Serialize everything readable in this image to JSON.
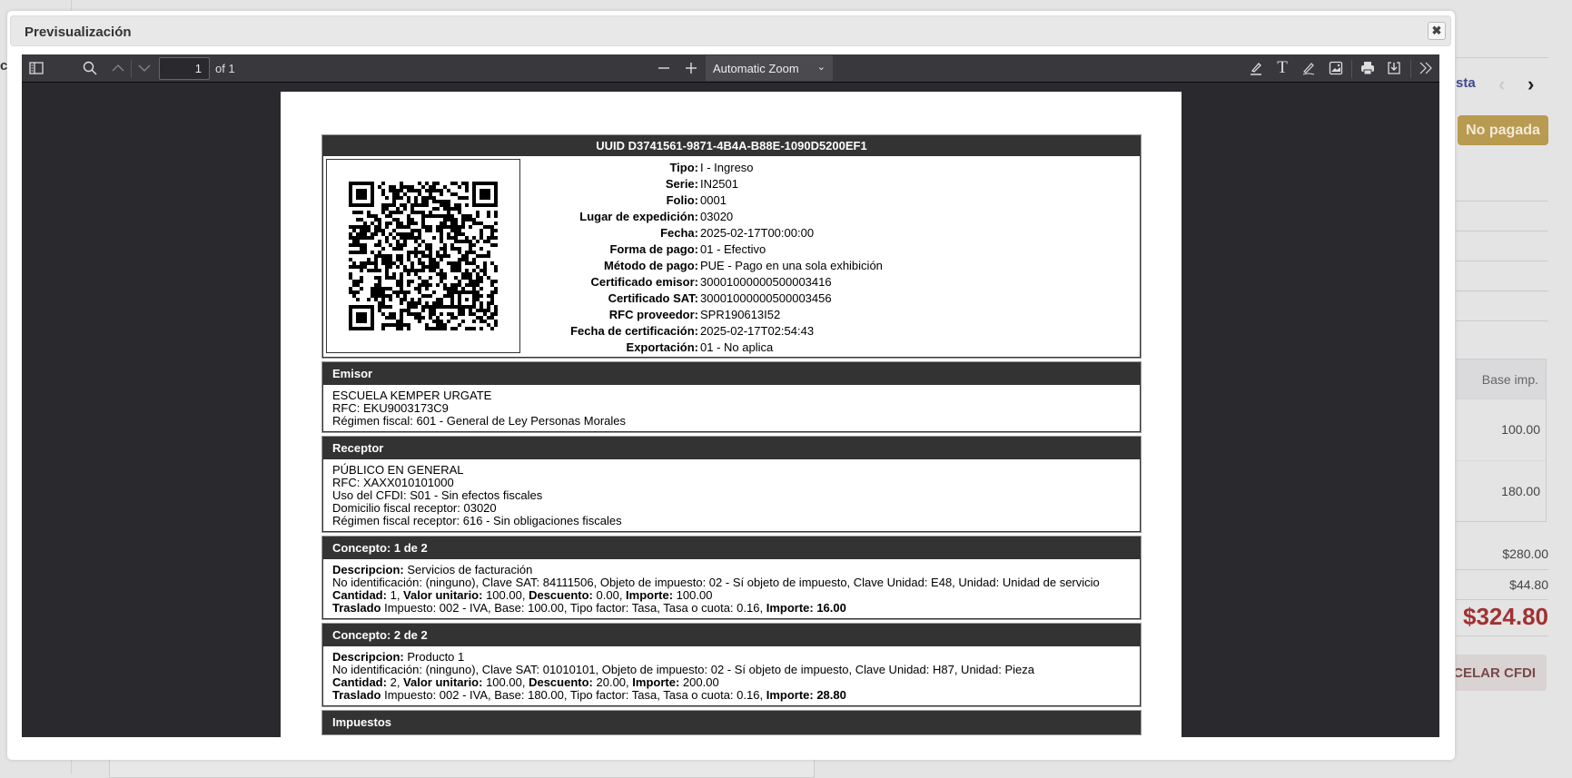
{
  "background": {
    "left_fragment": "cl",
    "link_fragment": "sta",
    "prev_icon": "chevron-left-icon",
    "next_icon": "chevron-right-icon",
    "status_badge": "No pagada",
    "status_color": "#b89a50",
    "table_header": "Base imp.",
    "table_rows": [
      "100.00",
      "180.00"
    ],
    "subtotal": "$280.00",
    "tax": "$44.80",
    "total": "$324.80",
    "total_color": "#a03232",
    "cancel_button": "CELAR CFDI"
  },
  "modal": {
    "title": "Previsualización",
    "close_icon": "close-icon"
  },
  "viewer": {
    "page_number": "1",
    "page_count": "of 1",
    "zoom": "Automatic Zoom",
    "icons": [
      "sidebar-toggle-icon",
      "search-icon",
      "previous-page-icon",
      "next-page-icon",
      "zoom-out-icon",
      "zoom-in-icon",
      "highlight-icon",
      "text-icon",
      "draw-icon",
      "image-icon",
      "print-icon",
      "save-icon",
      "tools-icon"
    ]
  },
  "document": {
    "uuid": "UUID D3741561-9871-4B4A-B88E-1090D5200EF1",
    "info": [
      {
        "label": "Tipo:",
        "value": "I - Ingreso"
      },
      {
        "label": "Serie:",
        "value": "IN2501"
      },
      {
        "label": "Folio:",
        "value": "0001"
      },
      {
        "label": "Lugar de expedición:",
        "value": "03020"
      },
      {
        "label": "Fecha:",
        "value": "2025-02-17T00:00:00"
      },
      {
        "label": "Forma de pago:",
        "value": "01 - Efectivo"
      },
      {
        "label": "Método de pago:",
        "value": "PUE - Pago en una sola exhibición"
      },
      {
        "label": "Certificado emisor:",
        "value": "30001000000500003416"
      },
      {
        "label": "Certificado SAT:",
        "value": "30001000000500003456"
      },
      {
        "label": "RFC proveedor:",
        "value": "SPR190613I52"
      },
      {
        "label": "Fecha de certificación:",
        "value": "2025-02-17T02:54:43"
      },
      {
        "label": "Exportación:",
        "value": "01 - No aplica"
      }
    ],
    "emisor": {
      "title": "Emisor",
      "lines": [
        "ESCUELA KEMPER URGATE",
        "RFC: EKU9003173C9",
        "Régimen fiscal: 601 - General de Ley Personas Morales"
      ]
    },
    "receptor": {
      "title": "Receptor",
      "lines": [
        "PÚBLICO EN GENERAL",
        "RFC: XAXX010101000",
        "Uso del CFDI: S01 - Sin efectos fiscales",
        "Domicilio fiscal receptor: 03020",
        "Régimen fiscal receptor: 616 - Sin obligaciones fiscales"
      ]
    },
    "conceptos": [
      {
        "title": "Concepto: 1 de 2",
        "desc_label": "Descripcion:",
        "desc": "Servicios de facturación",
        "ident": "No identificación: (ninguno), Clave SAT: 84111506, Objeto de impuesto: 02 - Sí objeto de impuesto, Clave Unidad: E48, Unidad: Unidad de servicio",
        "cantidad_label": "Cantidad:",
        "cantidad": "1",
        "valor_label": "Valor unitario:",
        "valor": "100.00",
        "descuento_label": "Descuento:",
        "descuento": "0.00",
        "importe_label": "Importe:",
        "importe": "100.00",
        "traslado_label": "Traslado",
        "traslado": "Impuesto: 002 - IVA, Base: 100.00, Tipo factor: Tasa, Tasa o cuota: 0.16,",
        "traslado_importe": "Importe: 16.00"
      },
      {
        "title": "Concepto: 2 de 2",
        "desc_label": "Descripcion:",
        "desc": "Producto 1",
        "ident": "No identificación: (ninguno), Clave SAT: 01010101, Objeto de impuesto: 02 - Sí objeto de impuesto, Clave Unidad: H87, Unidad: Pieza",
        "cantidad_label": "Cantidad:",
        "cantidad": "2",
        "valor_label": "Valor unitario:",
        "valor": "100.00",
        "descuento_label": "Descuento:",
        "descuento": "20.00",
        "importe_label": "Importe:",
        "importe": "200.00",
        "traslado_label": "Traslado",
        "traslado": "Impuesto: 002 - IVA, Base: 180.00, Tipo factor: Tasa, Tasa o cuota: 0.16,",
        "traslado_importe": "Importe: 28.80"
      }
    ],
    "impuestos_title": "Impuestos"
  }
}
